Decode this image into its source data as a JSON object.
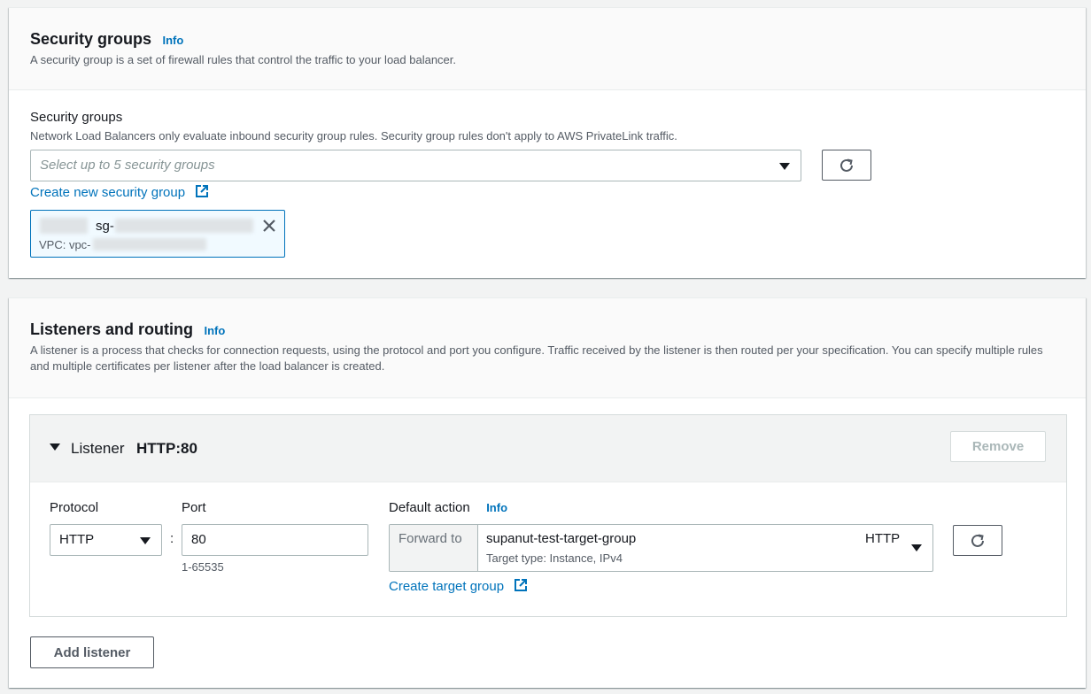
{
  "security_panel": {
    "title": "Security groups",
    "info": "Info",
    "description": "A security group is a set of firewall rules that control the traffic to your load balancer.",
    "field_label": "Security groups",
    "field_hint": "Network Load Balancers only evaluate inbound security group rules. Security group rules don't apply to AWS PrivateLink traffic.",
    "select_placeholder": "Select up to 5 security groups",
    "create_link": "Create new security group",
    "token": {
      "sg_prefix": "sg-",
      "vpc_prefix": "VPC: vpc-"
    }
  },
  "listeners_panel": {
    "title": "Listeners and routing",
    "info": "Info",
    "description": "A listener is a process that checks for connection requests, using the protocol and port you configure. Traffic received by the listener is then routed per your specification. You can specify multiple rules and multiple certificates per listener after the load balancer is created.",
    "listener": {
      "prefix": "Listener",
      "name": "HTTP:80",
      "remove_label": "Remove",
      "protocol_label": "Protocol",
      "protocol_value": "HTTP",
      "colon": ":",
      "port_label": "Port",
      "port_value": "80",
      "port_hint": "1-65535",
      "default_action_label": "Default action",
      "default_action_info": "Info",
      "forward_to": "Forward to",
      "target_group_name": "supanut-test-target-group",
      "target_group_protocol": "HTTP",
      "target_type": "Target type: Instance, IPv4",
      "create_target_link": "Create target group"
    },
    "add_listener_label": "Add listener"
  }
}
